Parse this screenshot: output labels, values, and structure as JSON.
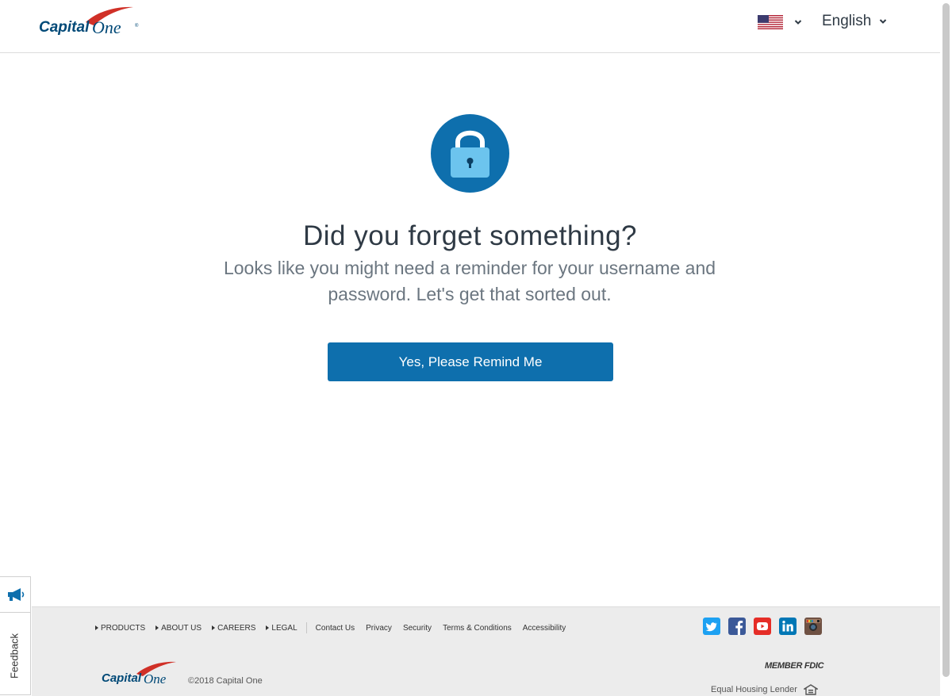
{
  "header": {
    "brand": "Capital One",
    "flag_icon": "us-flag-icon",
    "language": "English",
    "dropdown_icon": "chevron-down-icon"
  },
  "main": {
    "icon": "lock-icon",
    "title": "Did you forget something?",
    "subtitle": "Looks like you might need a reminder for your username and password. Let's get that sorted out.",
    "cta_label": "Yes, Please Remind Me"
  },
  "footer": {
    "nav": [
      {
        "label": "PRODUCTS"
      },
      {
        "label": "ABOUT US"
      },
      {
        "label": "CAREERS"
      },
      {
        "label": "LEGAL"
      }
    ],
    "links": [
      {
        "label": "Contact Us"
      },
      {
        "label": "Privacy"
      },
      {
        "label": "Security"
      },
      {
        "label": "Terms & Conditions"
      },
      {
        "label": "Accessibility"
      }
    ],
    "social": [
      "twitter-icon",
      "facebook-icon",
      "youtube-icon",
      "linkedin-icon",
      "instagram-icon"
    ],
    "brand": "Capital One",
    "copyright": "©2018 Capital One",
    "fdic": "MEMBER FDIC",
    "equal_housing": "Equal Housing Lender"
  },
  "feedback": {
    "label": "Feedback",
    "icon": "megaphone-icon"
  },
  "colors": {
    "primary_blue": "#0e6fad",
    "brand_navy": "#004977",
    "brand_red": "#d03027",
    "lock_light": "#6cc4ee",
    "footer_bg": "#ececec"
  }
}
